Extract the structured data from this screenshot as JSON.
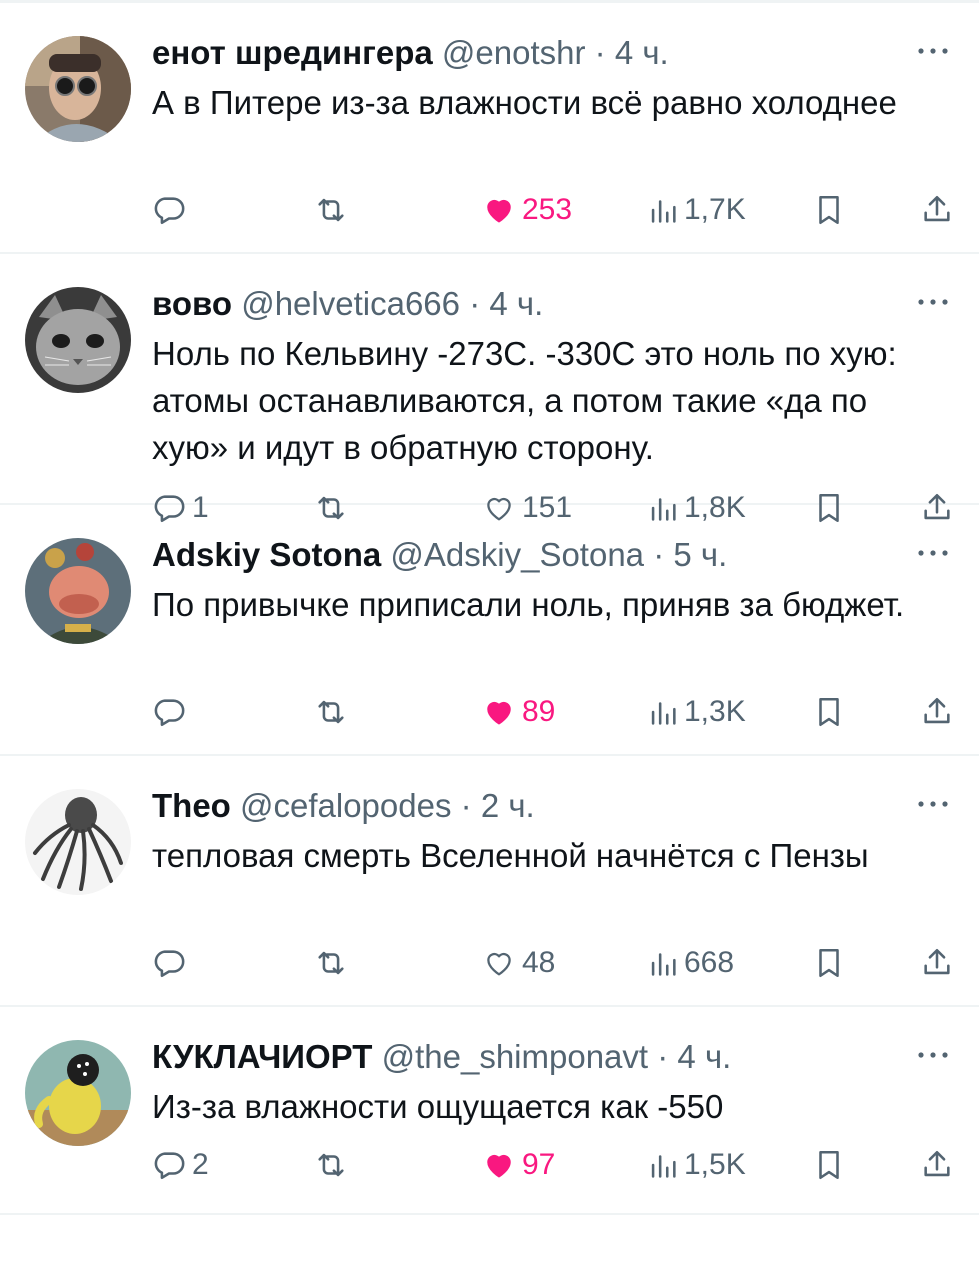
{
  "colors": {
    "text": "#0f1419",
    "secondary": "#536471",
    "like_active": "#f91880",
    "divider": "#eff3f4"
  },
  "icons": {
    "reply": "reply-icon",
    "retweet": "retweet-icon",
    "like": "heart-icon",
    "views": "views-icon",
    "bookmark": "bookmark-icon",
    "share": "share-icon",
    "more": "more-icon"
  },
  "tweets": [
    {
      "name": "енот шредингера",
      "handle": "@enotshr",
      "dot": "·",
      "time": "4 ч.",
      "text": "А в Питере из-за влажности всё равно холоднее",
      "replies": "",
      "likes": "253",
      "liked": true,
      "views": "1,7K",
      "avatar": "avatar-photo-man-sunglasses"
    },
    {
      "name": "вово",
      "handle": "@helvetica666",
      "dot": "·",
      "time": "4 ч.",
      "text": "Ноль по Кельвину -273С. -330С это ноль по хую: атомы останавливаются, а потом такие «да по хую» и идут в обратную сторону.",
      "replies": "1",
      "likes": "151",
      "liked": false,
      "views": "1,8K",
      "avatar": "avatar-cat-grayscale"
    },
    {
      "name": "Adskiy Sotona",
      "handle": "@Adskiy_Sotona",
      "dot": "·",
      "time": "5 ч.",
      "text": "По привычке приписали ноль, приняв за бюджет.",
      "replies": "",
      "likes": "89",
      "liked": true,
      "views": "1,3K",
      "avatar": "avatar-cartoon-general"
    },
    {
      "name": "Theo",
      "handle": "@cefalopodes",
      "dot": "·",
      "time": "2 ч.",
      "text": "тепловая смерть Вселенной начнётся с Пензы",
      "replies": "",
      "likes": "48",
      "liked": false,
      "views": "668",
      "avatar": "avatar-octopus-engraving"
    },
    {
      "name": "КУКЛАЧИОРТ",
      "handle": "@the_shimponavt",
      "dot": "·",
      "time": "4 ч.",
      "text": "Из-за влажности ощущается как -550",
      "replies": "2",
      "likes": "97",
      "liked": true,
      "views": "1,5K",
      "avatar": "avatar-yellow-figure-painting"
    }
  ]
}
